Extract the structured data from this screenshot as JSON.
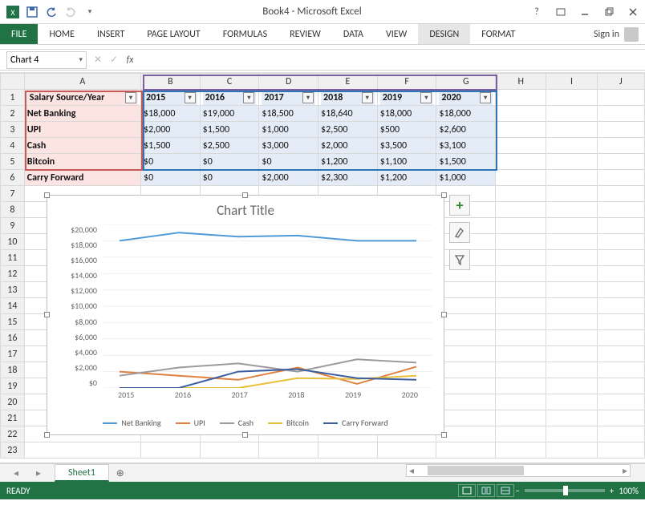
{
  "window": {
    "title": "Book4 - Microsoft Excel",
    "sign_in": "Sign in"
  },
  "ribbon": {
    "file": "FILE",
    "tabs": [
      "HOME",
      "INSERT",
      "PAGE LAYOUT",
      "FORMULAS",
      "REVIEW",
      "DATA",
      "VIEW",
      "DESIGN",
      "FORMAT"
    ],
    "active": "DESIGN"
  },
  "formula_bar": {
    "name_box": "Chart 4",
    "cancel": "✕",
    "enter": "✓",
    "fx": "fx",
    "value": ""
  },
  "columns": [
    "A",
    "B",
    "C",
    "D",
    "E",
    "F",
    "G",
    "H",
    "I",
    "J"
  ],
  "table": {
    "corner": "Salary Source/Year",
    "years": [
      "2015",
      "2016",
      "2017",
      "2018",
      "2019",
      "2020"
    ],
    "rows": [
      {
        "src": "Net Banking",
        "vals": [
          "$18,000",
          "$19,000",
          "$18,500",
          "$18,640",
          "$18,000",
          "$18,000"
        ]
      },
      {
        "src": "UPI",
        "vals": [
          "$2,000",
          "$1,500",
          "$1,000",
          "$2,500",
          "$500",
          "$2,600"
        ]
      },
      {
        "src": "Cash",
        "vals": [
          "$1,500",
          "$2,500",
          "$3,000",
          "$2,000",
          "$3,500",
          "$3,100"
        ]
      },
      {
        "src": "Bitcoin",
        "vals": [
          "$0",
          "$0",
          "$0",
          "$1,200",
          "$1,100",
          "$1,500"
        ]
      },
      {
        "src": "Carry Forward",
        "vals": [
          "$0",
          "$0",
          "$2,000",
          "$2,300",
          "$1,200",
          "$1,000"
        ]
      }
    ]
  },
  "chart_data": {
    "type": "line",
    "title": "Chart Title",
    "categories": [
      "2015",
      "2016",
      "2017",
      "2018",
      "2019",
      "2020"
    ],
    "series": [
      {
        "name": "Net Banking",
        "color": "#4f9bd9",
        "values": [
          18000,
          19000,
          18500,
          18640,
          18000,
          18000
        ]
      },
      {
        "name": "UPI",
        "color": "#e08040",
        "values": [
          2000,
          1500,
          1000,
          2500,
          500,
          2600
        ]
      },
      {
        "name": "Cash",
        "color": "#9b9b9b",
        "values": [
          1500,
          2500,
          3000,
          2000,
          3500,
          3100
        ]
      },
      {
        "name": "Bitcoin",
        "color": "#e8bf3a",
        "values": [
          0,
          0,
          0,
          1200,
          1100,
          1500
        ]
      },
      {
        "name": "Carry Forward",
        "color": "#3b5fa0",
        "values": [
          0,
          0,
          2000,
          2300,
          1200,
          1000
        ]
      }
    ],
    "ylim": [
      0,
      20000
    ],
    "yticks": [
      "$20,000",
      "$18,000",
      "$16,000",
      "$14,000",
      "$12,000",
      "$10,000",
      "$8,000",
      "$6,000",
      "$4,000",
      "$2,000",
      "$0"
    ],
    "xlabel": "",
    "ylabel": ""
  },
  "sheet": {
    "active": "Sheet1"
  },
  "status": {
    "ready": "READY",
    "zoom": "100%"
  }
}
